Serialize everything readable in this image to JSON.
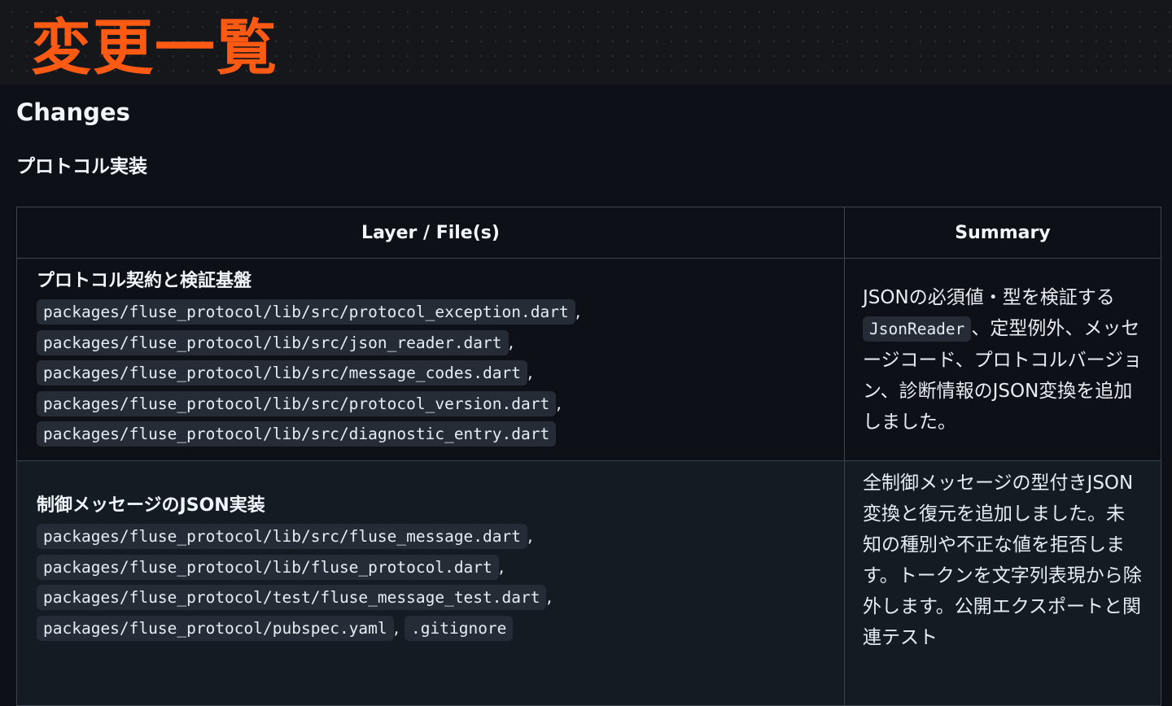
{
  "banner": {
    "title": "変更一覧"
  },
  "section": {
    "heading": "Changes",
    "subheading": "プロトコル実装"
  },
  "table": {
    "headers": {
      "layer": "Layer / File(s)",
      "summary": "Summary"
    },
    "rows": [
      {
        "title": "プロトコル契約と検証基盤",
        "files": [
          {
            "path": "packages/fluse_protocol/lib/src/protocol_exception.dart",
            "sep": ","
          },
          {
            "path": "packages/fluse_protocol/lib/src/json_reader.dart",
            "sep": ","
          },
          {
            "path": "packages/fluse_protocol/lib/src/message_codes.dart",
            "sep": ","
          },
          {
            "path": "packages/fluse_protocol/lib/src/protocol_version.dart",
            "sep": ","
          },
          {
            "path": "packages/fluse_protocol/lib/src/diagnostic_entry.dart",
            "sep": ""
          }
        ],
        "summary_pre": "JSONの必須値・型を検証する",
        "summary_code": "JsonReader",
        "summary_post": "、定型例外、メッセージコード、プロトコルバージョン、診断情報のJSON変換を追加しました。"
      },
      {
        "title": "制御メッセージのJSON実装",
        "files": [
          {
            "path": "packages/fluse_protocol/lib/src/fluse_message.dart",
            "sep": ","
          },
          {
            "path": "packages/fluse_protocol/lib/fluse_protocol.dart",
            "sep": ","
          },
          {
            "path": "packages/fluse_protocol/test/fluse_message_test.dart",
            "sep": ","
          },
          {
            "path": "packages/fluse_protocol/pubspec.yaml",
            "sep": ",",
            "extra": ".gitignore"
          }
        ],
        "summary_text": "全制御メッセージの型付きJSON変換と復元を追加しました。未知の種別や不正な値を拒否します。トークンを文字列表現から除外します。公開エクスポートと関連テスト"
      }
    ]
  }
}
